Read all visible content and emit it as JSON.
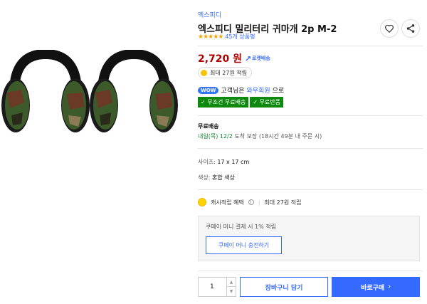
{
  "product": {
    "brand": "엑스피디",
    "title": "엑스피디 밀리터리 귀마개 2p M-2",
    "stars": "★★★★★",
    "rating_count": "45개 상품평",
    "price": "2,720 원",
    "rocket_label": "로켓배송",
    "reward": "최대 27원 적립"
  },
  "wow": {
    "badge": "WOW",
    "text_prefix": "고객님은",
    "link": "와우회원",
    "text_suffix": "으로"
  },
  "benefits": [
    {
      "label": "✓ 무조건 무료배송"
    },
    {
      "label": "✓ 무료반품"
    }
  ],
  "shipping": {
    "label": "무료배송",
    "date": "내일(목) 12/2",
    "guarantee": "도착 보장",
    "note": "(18시간 49분 내 주문 시)"
  },
  "options": {
    "size_label": "사이즈:",
    "size_value": "17 x 17 cm",
    "color_label": "색상:",
    "color_value": "혼합 색상"
  },
  "cash": {
    "label": "캐시적립 혜택",
    "info_icon": "i",
    "separator": "|",
    "detail": "최대 27원 적립"
  },
  "coupay": {
    "text": "쿠페이 머니 결제 시 1% 적립",
    "button": "쿠페이 머니 충전하기"
  },
  "purchase": {
    "quantity": "1",
    "cart_button": "장바구니 담기",
    "buy_button": "바로구매",
    "buy_arrow": "›"
  },
  "colors": {
    "accent": "#346aff",
    "price": "#ae0000",
    "benefit_green": "#0d8a0d",
    "camo_green": "#3c5a2a",
    "camo_brown": "#6b3a26"
  },
  "icons": [
    "heart-icon",
    "share-icon",
    "coin-icon",
    "info-icon",
    "chevron-up-icon",
    "chevron-down-icon",
    "chevron-right-icon"
  ]
}
